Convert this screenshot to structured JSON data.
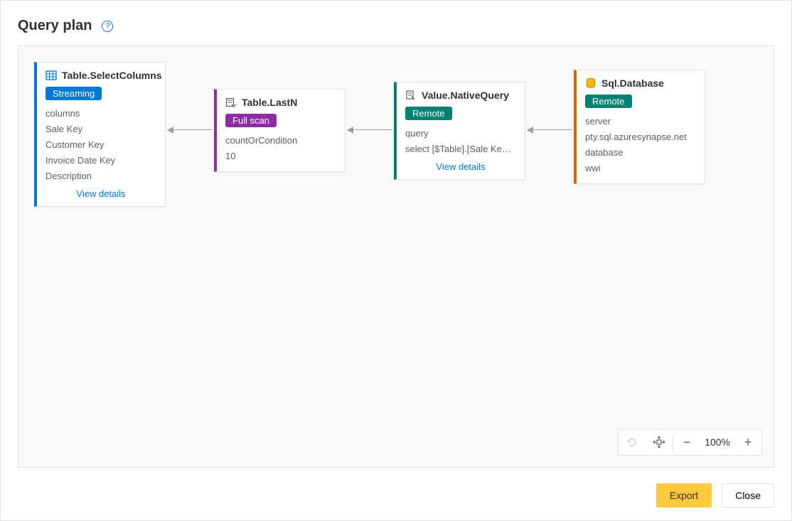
{
  "header": {
    "title": "Query plan"
  },
  "nodes": {
    "selectColumns": {
      "title": "Table.SelectColumns",
      "badge": "Streaming",
      "lines": [
        "columns",
        "Sale Key",
        "Customer Key",
        "Invoice Date Key",
        "Description"
      ],
      "viewDetails": "View details"
    },
    "lastN": {
      "title": "Table.LastN",
      "badge": "Full scan",
      "lines": [
        "countOrCondition",
        "10"
      ]
    },
    "nativeQuery": {
      "title": "Value.NativeQuery",
      "badge": "Remote",
      "lines": [
        "query",
        "select [$Table].[Sale Ke…"
      ],
      "viewDetails": "View details"
    },
    "database": {
      "title": "Sql.Database",
      "badge": "Remote",
      "lines": [
        "server",
        "pty.sql.azuresynapse.net",
        "database",
        "wwi"
      ]
    }
  },
  "zoom": {
    "percent": "100%"
  },
  "footer": {
    "export": "Export",
    "close": "Close"
  }
}
